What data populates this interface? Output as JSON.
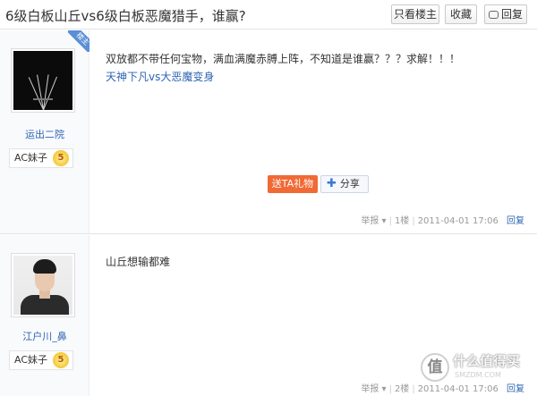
{
  "header": {
    "title": "6级白板山丘vs6级白板恶魔猎手，谁赢?",
    "only_op_label": "只看楼主",
    "favorite_label": "收藏",
    "reply_label": "回复"
  },
  "posts": [
    {
      "username": "运出二院",
      "rank": "AC妹子",
      "level": "5",
      "op_badge": "楼主",
      "lines": [
        "双放都不带任何宝物，满血满魔赤膊上阵，不知道是谁赢？？？求解！！！",
        "天神下凡vs大恶魔变身"
      ],
      "gift_label": "送TA礼物",
      "share_label": "分享",
      "report": "举报",
      "floor": "1楼",
      "time": "2011-04-01 17:06",
      "reply": "回复"
    },
    {
      "username": "江户川_鼻",
      "rank": "AC妹子",
      "level": "5",
      "lines": [
        "山丘想输都难"
      ],
      "report": "举报",
      "floor": "2楼",
      "time": "2011-04-01 17:06",
      "reply": "回复"
    }
  ],
  "watermark": {
    "logo_char": "值",
    "text": "什么值得买",
    "sub": "SMZDM.COM"
  },
  "colors": {
    "link_blue": "#2d64b3",
    "gift_orange": "#f06a35",
    "badge_blue": "#5b8fd6",
    "level_gold": "#f0b400"
  },
  "icons": [
    "reply-icon",
    "share-plus-icon",
    "level-badge-icon",
    "avatar-image"
  ]
}
